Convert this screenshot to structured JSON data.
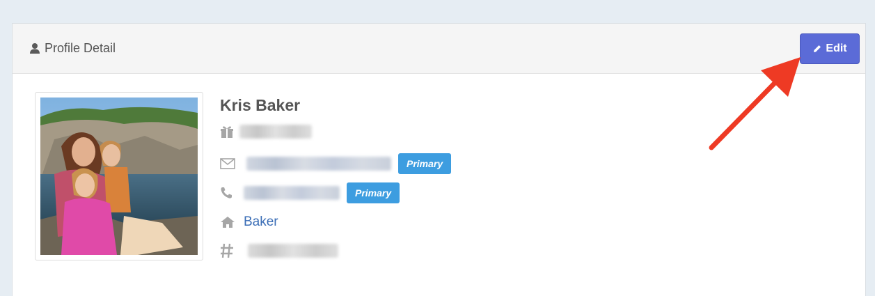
{
  "panel": {
    "title": "Profile Detail",
    "title_icon": "user-icon",
    "edit_label": "Edit",
    "edit_icon": "pencil-icon"
  },
  "profile": {
    "name": "Kris Baker",
    "photo_alt": "",
    "birthday": {
      "icon": "gift-icon",
      "redacted": true
    },
    "email": {
      "icon": "envelope-icon",
      "redacted": true,
      "badge": "Primary"
    },
    "phone": {
      "icon": "phone-icon",
      "redacted": true,
      "badge": "Primary"
    },
    "address": {
      "icon": "home-icon",
      "label": "Baker"
    },
    "id_number": {
      "icon": "hash-icon",
      "redacted": true
    }
  },
  "colors": {
    "edit_button": "#5b6bd7",
    "badge": "#3d9de0",
    "link": "#3a6db6",
    "annotation_arrow": "#ee3a24"
  }
}
